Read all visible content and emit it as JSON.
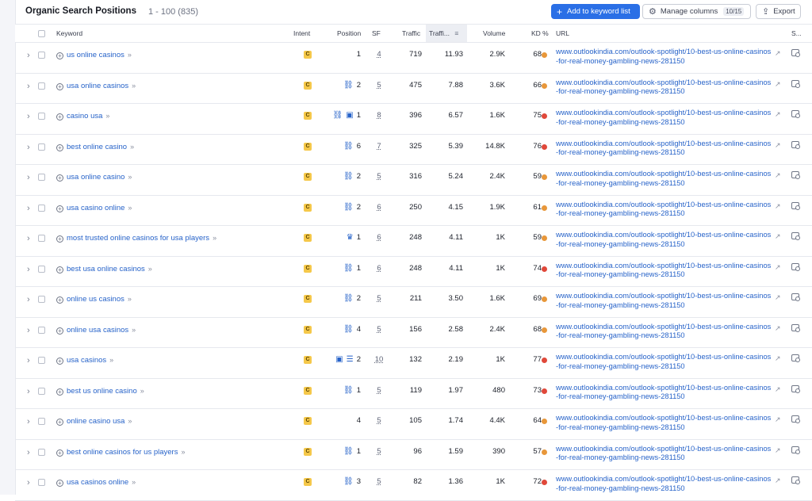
{
  "header": {
    "title": "Organic Search Positions",
    "subtitle": "1 - 100 (835)",
    "add_button": "Add to keyword list",
    "manage_button": "Manage columns",
    "manage_badge": "10/15",
    "export_button": "Export"
  },
  "columns": {
    "keyword": "Keyword",
    "intent": "Intent",
    "position": "Position",
    "sf": "SF",
    "traffic": "Traffic",
    "traffic_pct": "Traffi...",
    "volume": "Volume",
    "kd": "KD %",
    "url": "URL",
    "serp": "S..."
  },
  "colors": {
    "orange": "#e8973a",
    "red": "#e0483a",
    "accent": "#2a6fe6"
  },
  "rows": [
    {
      "keyword": "us online casinos",
      "intent": "C",
      "pos_icons": [],
      "position": "1",
      "sf": "4",
      "traffic": "719",
      "traffic_pct": "11.93",
      "volume": "2.9K",
      "kd": "68",
      "kd_color": "#e8973a",
      "url": "www.outlookindia.com/outlook-spotlight/10-best-us-online-casinos-for-real-money-gambling-news-281150"
    },
    {
      "keyword": "usa online casinos",
      "intent": "C",
      "pos_icons": [
        "link-icon"
      ],
      "position": "2",
      "sf": "5",
      "traffic": "475",
      "traffic_pct": "7.88",
      "volume": "3.6K",
      "kd": "66",
      "kd_color": "#e8973a",
      "url": "www.outlookindia.com/outlook-spotlight/10-best-us-online-casinos-for-real-money-gambling-news-281150"
    },
    {
      "keyword": "casino usa",
      "intent": "C",
      "pos_icons": [
        "link-icon",
        "image-icon"
      ],
      "position": "1",
      "sf": "8",
      "traffic": "396",
      "traffic_pct": "6.57",
      "volume": "1.6K",
      "kd": "75",
      "kd_color": "#e0483a",
      "url": "www.outlookindia.com/outlook-spotlight/10-best-us-online-casinos-for-real-money-gambling-news-281150"
    },
    {
      "keyword": "best online casino",
      "intent": "C",
      "pos_icons": [
        "link-icon"
      ],
      "position": "6",
      "sf": "7",
      "traffic": "325",
      "traffic_pct": "5.39",
      "volume": "14.8K",
      "kd": "76",
      "kd_color": "#e0483a",
      "url": "www.outlookindia.com/outlook-spotlight/10-best-us-online-casinos-for-real-money-gambling-news-281150"
    },
    {
      "keyword": "usa online casino",
      "intent": "C",
      "pos_icons": [
        "link-icon"
      ],
      "position": "2",
      "sf": "5",
      "traffic": "316",
      "traffic_pct": "5.24",
      "volume": "2.4K",
      "kd": "59",
      "kd_color": "#e8973a",
      "url": "www.outlookindia.com/outlook-spotlight/10-best-us-online-casinos-for-real-money-gambling-news-281150"
    },
    {
      "keyword": "usa casino online",
      "intent": "C",
      "pos_icons": [
        "link-icon"
      ],
      "position": "2",
      "sf": "6",
      "traffic": "250",
      "traffic_pct": "4.15",
      "volume": "1.9K",
      "kd": "61",
      "kd_color": "#e8973a",
      "url": "www.outlookindia.com/outlook-spotlight/10-best-us-online-casinos-for-real-money-gambling-news-281150"
    },
    {
      "keyword": "most trusted online casinos for usa players",
      "intent": "C",
      "pos_icons": [
        "crown-icon"
      ],
      "position": "1",
      "sf": "6",
      "traffic": "248",
      "traffic_pct": "4.11",
      "volume": "1K",
      "kd": "59",
      "kd_color": "#e8973a",
      "url": "www.outlookindia.com/outlook-spotlight/10-best-us-online-casinos-for-real-money-gambling-news-281150"
    },
    {
      "keyword": "best usa online casinos",
      "intent": "C",
      "pos_icons": [
        "link-icon"
      ],
      "position": "1",
      "sf": "6",
      "traffic": "248",
      "traffic_pct": "4.11",
      "volume": "1K",
      "kd": "74",
      "kd_color": "#e0483a",
      "url": "www.outlookindia.com/outlook-spotlight/10-best-us-online-casinos-for-real-money-gambling-news-281150"
    },
    {
      "keyword": "online us casinos",
      "intent": "C",
      "pos_icons": [
        "link-icon"
      ],
      "position": "2",
      "sf": "5",
      "traffic": "211",
      "traffic_pct": "3.50",
      "volume": "1.6K",
      "kd": "69",
      "kd_color": "#e8973a",
      "url": "www.outlookindia.com/outlook-spotlight/10-best-us-online-casinos-for-real-money-gambling-news-281150"
    },
    {
      "keyword": "online usa casinos",
      "intent": "C",
      "pos_icons": [
        "link-icon"
      ],
      "position": "4",
      "sf": "5",
      "traffic": "156",
      "traffic_pct": "2.58",
      "volume": "2.4K",
      "kd": "68",
      "kd_color": "#e8973a",
      "url": "www.outlookindia.com/outlook-spotlight/10-best-us-online-casinos-for-real-money-gambling-news-281150"
    },
    {
      "keyword": "usa casinos",
      "intent": "C",
      "pos_icons": [
        "image-icon",
        "list-icon"
      ],
      "position": "2",
      "sf": "10",
      "traffic": "132",
      "traffic_pct": "2.19",
      "volume": "1K",
      "kd": "77",
      "kd_color": "#e0483a",
      "url": "www.outlookindia.com/outlook-spotlight/10-best-us-online-casinos-for-real-money-gambling-news-281150"
    },
    {
      "keyword": "best us online casino",
      "intent": "C",
      "pos_icons": [
        "link-icon"
      ],
      "position": "1",
      "sf": "5",
      "traffic": "119",
      "traffic_pct": "1.97",
      "volume": "480",
      "kd": "73",
      "kd_color": "#e0483a",
      "url": "www.outlookindia.com/outlook-spotlight/10-best-us-online-casinos-for-real-money-gambling-news-281150"
    },
    {
      "keyword": "online casino usa",
      "intent": "C",
      "pos_icons": [],
      "position": "4",
      "sf": "5",
      "traffic": "105",
      "traffic_pct": "1.74",
      "volume": "4.4K",
      "kd": "64",
      "kd_color": "#e8973a",
      "url": "www.outlookindia.com/outlook-spotlight/10-best-us-online-casinos-for-real-money-gambling-news-281150"
    },
    {
      "keyword": "best online casinos for us players",
      "intent": "C",
      "pos_icons": [
        "link-icon"
      ],
      "position": "1",
      "sf": "5",
      "traffic": "96",
      "traffic_pct": "1.59",
      "volume": "390",
      "kd": "57",
      "kd_color": "#e8973a",
      "url": "www.outlookindia.com/outlook-spotlight/10-best-us-online-casinos-for-real-money-gambling-news-281150"
    },
    {
      "keyword": "usa casinos online",
      "intent": "C",
      "pos_icons": [
        "link-icon"
      ],
      "position": "3",
      "sf": "5",
      "traffic": "82",
      "traffic_pct": "1.36",
      "volume": "1K",
      "kd": "72",
      "kd_color": "#e0483a",
      "url": "www.outlookindia.com/outlook-spotlight/10-best-us-online-casinos-for-real-money-gambling-news-281150"
    }
  ]
}
